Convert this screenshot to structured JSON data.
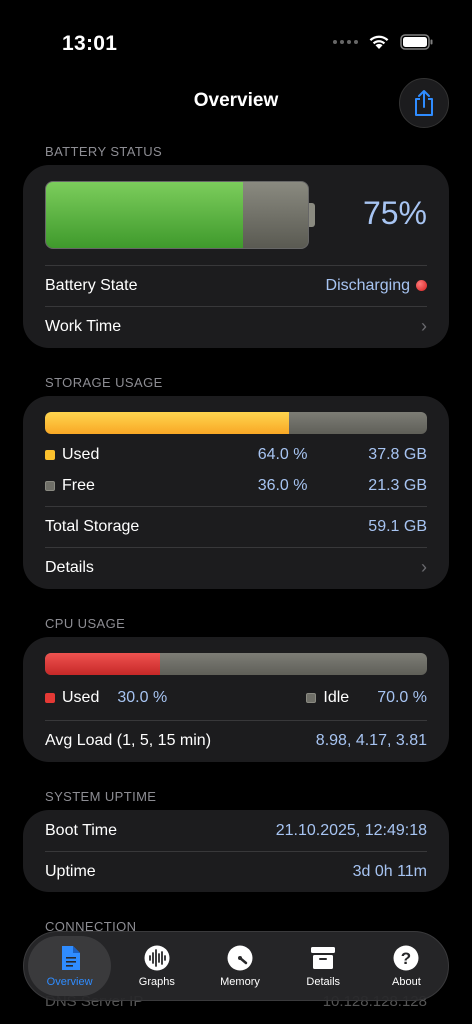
{
  "status": {
    "time": "13:01"
  },
  "nav": {
    "title": "Overview"
  },
  "battery": {
    "header": "BATTERY STATUS",
    "percent_label": "75%",
    "level": 0.75,
    "state_label": "Battery State",
    "state_value": "Discharging",
    "work_time_label": "Work Time"
  },
  "storage": {
    "header": "STORAGE USAGE",
    "used_fraction": 0.64,
    "used_label": "Used",
    "used_pct": "64.0 %",
    "used_size": "37.8 GB",
    "free_label": "Free",
    "free_pct": "36.0 %",
    "free_size": "21.3 GB",
    "total_label": "Total Storage",
    "total_value": "59.1 GB",
    "details_label": "Details"
  },
  "cpu": {
    "header": "CPU USAGE",
    "used_fraction": 0.3,
    "used_label": "Used",
    "used_pct": "30.0 %",
    "idle_label": "Idle",
    "idle_pct": "70.0 %",
    "load_label": "Avg Load (1, 5, 15 min)",
    "load_value": "8.98, 4.17, 3.81"
  },
  "uptime": {
    "header": "SYSTEM UPTIME",
    "boot_label": "Boot Time",
    "boot_value": "21.10.2025, 12:49:18",
    "uptime_label": "Uptime",
    "uptime_value": "3d 0h 11m"
  },
  "connection": {
    "header": "CONNECTION",
    "dns_label": "DNS Server IP",
    "dns_value": "10.128.128.128"
  },
  "tabs": [
    {
      "label": "Overview",
      "icon": "document-icon"
    },
    {
      "label": "Graphs",
      "icon": "waveform-icon"
    },
    {
      "label": "Memory",
      "icon": "gauge-icon"
    },
    {
      "label": "Details",
      "icon": "archive-icon"
    },
    {
      "label": "About",
      "icon": "question-icon"
    }
  ],
  "colors": {
    "accent": "#2f8cff",
    "battery_green": "#5cb544",
    "storage_yellow": "#fbc02d",
    "cpu_red": "#e53935",
    "value_blue": "#a7c4f2"
  }
}
